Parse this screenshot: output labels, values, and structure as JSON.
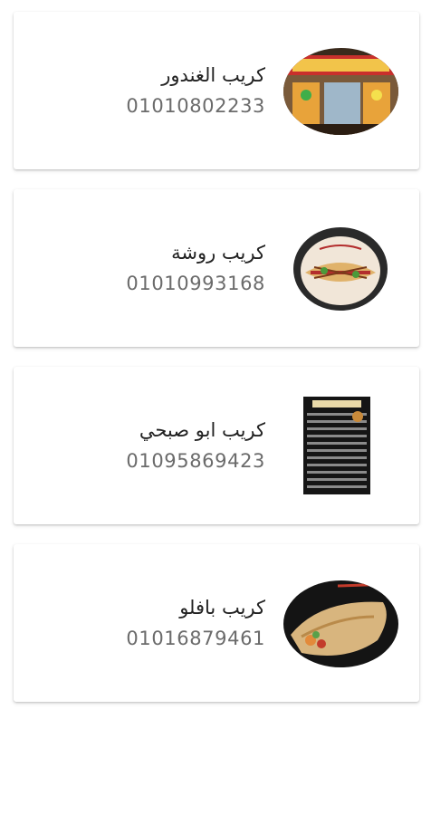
{
  "shops": [
    {
      "name": "كريب الغندور",
      "phone": "01010802233",
      "image": "storefront-photo"
    },
    {
      "name": "كريب روشة",
      "phone": "01010993168",
      "image": "crepe-plate-photo"
    },
    {
      "name": "كريب ابو صبحي",
      "phone": "01095869423",
      "image": "menu-board-photo"
    },
    {
      "name": "كريب بافلو",
      "phone": "01016879461",
      "image": "folded-crepe-photo"
    }
  ]
}
